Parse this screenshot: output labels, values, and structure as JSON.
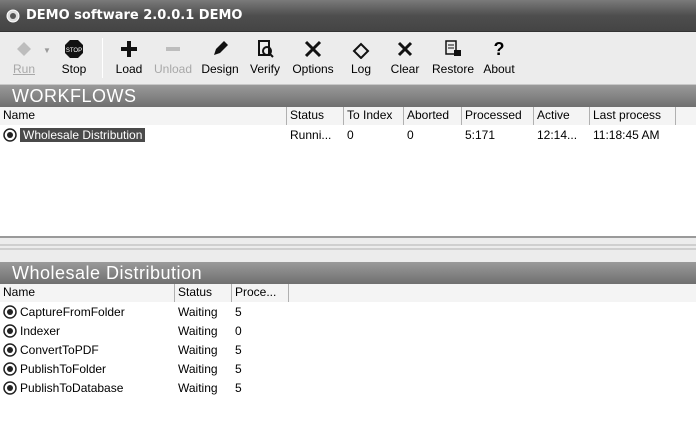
{
  "window": {
    "title": "DEMO software 2.0.0.1 DEMO"
  },
  "toolbar": {
    "run": "Run",
    "stop": "Stop",
    "load": "Load",
    "unload": "Unload",
    "design": "Design",
    "verify": "Verify",
    "options": "Options",
    "log": "Log",
    "clear": "Clear",
    "restore": "Restore",
    "about": "About"
  },
  "workflows": {
    "heading": "WORKFLOWS",
    "columns": [
      "Name",
      "Status",
      "To Index",
      "Aborted",
      "Processed",
      "Active",
      "Last process"
    ],
    "rows": [
      {
        "name": "Wholesale Distribution",
        "status": "Running",
        "status_display": "Runni...",
        "to_index": "0",
        "aborted": "0",
        "processed": "5:171",
        "active": "12:14...",
        "last_process": "11:18:45 AM"
      }
    ]
  },
  "details": {
    "heading": "Wholesale Distribution",
    "columns": [
      "Name",
      "Status",
      "Proce..."
    ],
    "rows": [
      {
        "name": "CaptureFromFolder",
        "status": "Waiting",
        "processed": "5"
      },
      {
        "name": "Indexer",
        "status": "Waiting",
        "processed": "0"
      },
      {
        "name": "ConvertToPDF",
        "status": "Waiting",
        "processed": "5"
      },
      {
        "name": "PublishToFolder",
        "status": "Waiting",
        "processed": "5"
      },
      {
        "name": "PublishToDatabase",
        "status": "Waiting",
        "processed": "5"
      }
    ]
  }
}
